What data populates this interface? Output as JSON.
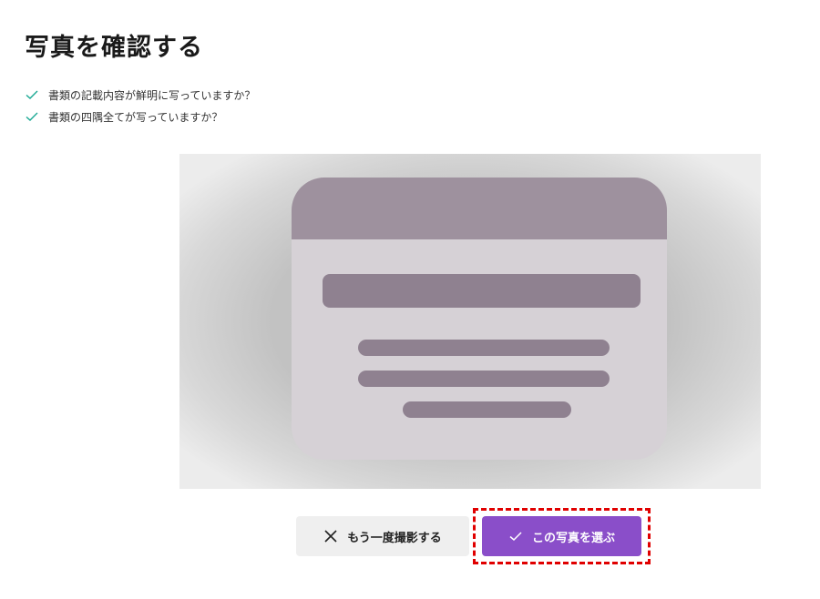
{
  "page": {
    "title": "写真を確認する"
  },
  "checklist": {
    "items": [
      {
        "label": "書類の記載内容が鮮明に写っていますか？",
        "icon": "check-icon"
      },
      {
        "label": "書類の四隅全てが写っていますか？",
        "icon": "check-icon"
      }
    ],
    "check_color": "#1aa893"
  },
  "preview": {
    "description_icon": "id-card-placeholder",
    "card_header_color": "#9e919e",
    "card_body_color": "#d6d1d6",
    "card_bar_color": "#8f8190"
  },
  "actions": {
    "retake_label": "もう一度撮影する",
    "retake_icon": "close-icon",
    "select_label": "この写真を選ぶ",
    "select_icon": "check-icon",
    "select_color": "#8a4ec9",
    "highlight_color": "#e00000"
  }
}
